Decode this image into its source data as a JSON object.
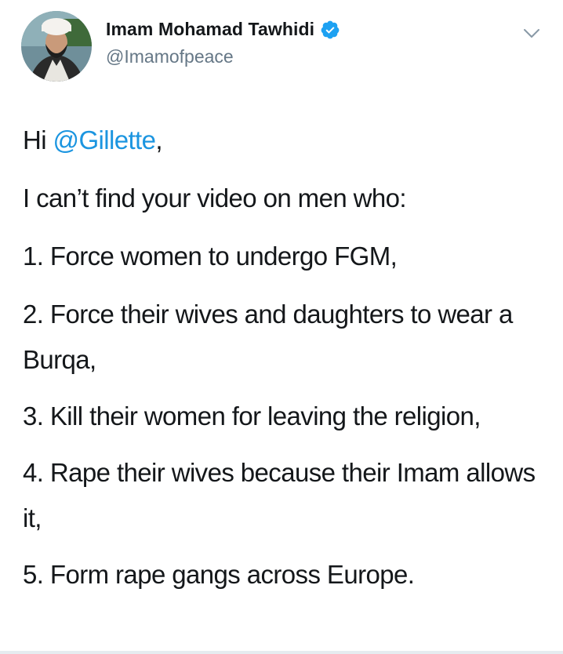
{
  "author": {
    "display_name": "Imam Mohamad Tawhidi",
    "handle": "@Imamofpeace",
    "verified": true,
    "avatar_icon": "profile-photo"
  },
  "menu": {
    "icon": "chevron-down-icon"
  },
  "tweet": {
    "greeting_prefix": "Hi ",
    "greeting_mention": "@Gillette",
    "greeting_suffix": ",",
    "intro": "I can’t find your video on men who:",
    "items": [
      "1. Force women to undergo FGM,",
      "2. Force their wives and daughters to wear a Burqa,",
      "3. Kill their women for leaving the religion,",
      "4. Rape their wives because their Imam allows it,",
      "5. Form rape gangs across Europe."
    ]
  },
  "colors": {
    "text": "#14171a",
    "handle": "#657786",
    "link": "#1b95e0",
    "verified_badge": "#1da1f2"
  }
}
